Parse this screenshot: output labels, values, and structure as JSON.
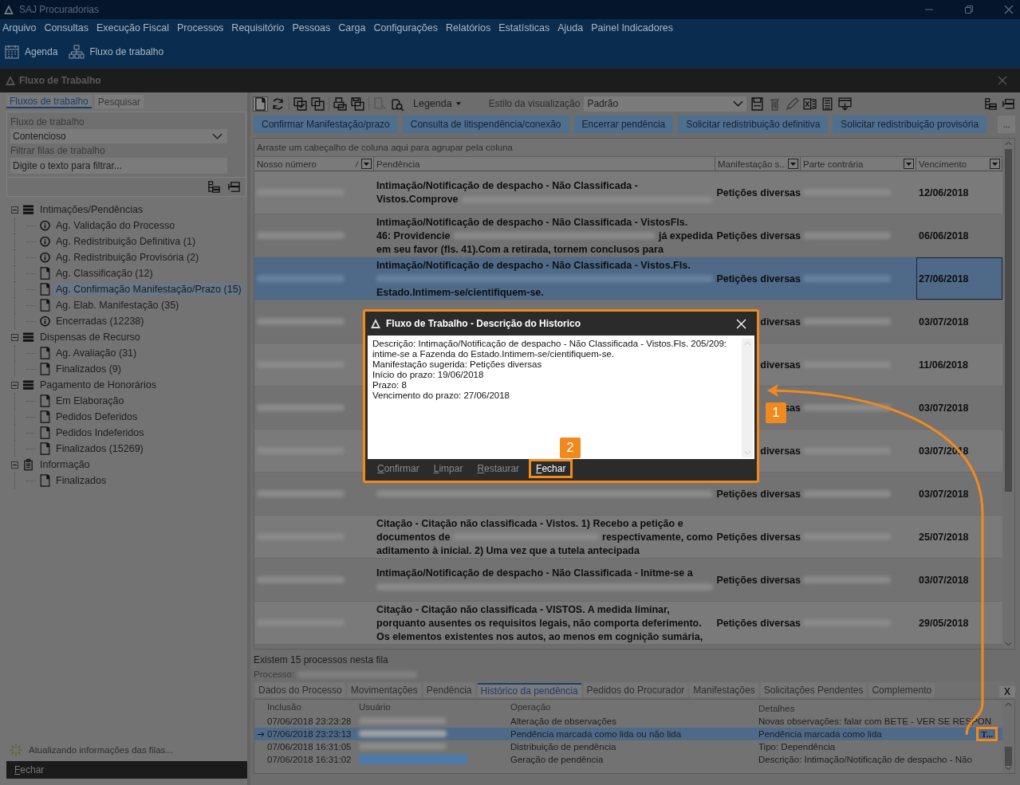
{
  "app_title": "SAJ Procuradorias",
  "menu": [
    "Arquivo",
    "Consultas",
    "Execução Fiscal",
    "Processos",
    "Requisitório",
    "Pessoas",
    "Carga",
    "Configurações",
    "Relatórios",
    "Estatísticas",
    "Ajuda",
    "Painel Indicadores"
  ],
  "quick_bar": [
    {
      "label": "Agenda",
      "kind": "calendar"
    },
    {
      "label": "Fluxo de trabalho",
      "kind": "hierarchy"
    }
  ],
  "window_title": "Fluxo de Trabalho",
  "left": {
    "tabs": [
      {
        "label": "Fluxos de trabalho",
        "selected": true
      },
      {
        "label": "Pesquisar",
        "selected": false
      }
    ],
    "workflow_label": "Fluxo de trabalho",
    "workflow_value": "Contencioso",
    "filter_label": "Filtrar filas de trabalho",
    "filter_placeholder": "Digite o texto para filtrar...",
    "tree": [
      {
        "label": "Intimações/Pendências",
        "kind": "list",
        "expanded": true,
        "selected": false,
        "children": [
          {
            "label": "Ag. Validação do Processo",
            "kind": "info",
            "selected": false
          },
          {
            "label": "Ag. Redistribuição Definitiva (1)",
            "kind": "info",
            "selected": false
          },
          {
            "label": "Ag. Redistribuição Provisória (2)",
            "kind": "info",
            "selected": false
          },
          {
            "label": "Ag. Classificação (12)",
            "kind": "doc",
            "selected": false
          },
          {
            "label": "Ag. Confirmação Manifestação/Prazo (15)",
            "kind": "doc",
            "selected": true
          },
          {
            "label": "Ag. Elab. Manifestação (35)",
            "kind": "doc",
            "selected": false
          },
          {
            "label": "Encerradas (12238)",
            "kind": "info",
            "selected": false
          }
        ]
      },
      {
        "label": "Dispensas de Recurso",
        "kind": "list",
        "expanded": true,
        "selected": false,
        "children": [
          {
            "label": "Ag. Avaliação (31)",
            "kind": "doc",
            "selected": false
          },
          {
            "label": "Finalizados (9)",
            "kind": "doc",
            "selected": false
          }
        ]
      },
      {
        "label": "Pagamento de Honorários",
        "kind": "list",
        "expanded": true,
        "selected": false,
        "children": [
          {
            "label": "Em Elaboração",
            "kind": "doc",
            "selected": false
          },
          {
            "label": "Pedidos Deferidos",
            "kind": "doc",
            "selected": false
          },
          {
            "label": "Pedidos Indeferidos",
            "kind": "doc",
            "selected": false
          },
          {
            "label": "Finalizados (15269)",
            "kind": "doc",
            "selected": false
          }
        ]
      },
      {
        "label": "Informação",
        "kind": "clipboard",
        "expanded": true,
        "selected": false,
        "children": [
          {
            "label": "Finalizados",
            "kind": "doc",
            "selected": false
          }
        ]
      }
    ],
    "status": "Atualizando informações das filas...",
    "close_button": "Fechar"
  },
  "toolbar": {
    "legend": "Legenda",
    "style_label": "Estilo da visualização",
    "style_value": "Padrão"
  },
  "actions": [
    "Confirmar Manifestação/prazo",
    "Consulta de litispendência/conexão",
    "Encerrar pendência",
    "Solicitar redistribuição definitiva",
    "Solicitar redistribuição provisória"
  ],
  "more_button": "...",
  "group_hint": "Arraste um cabeçalho de coluna aqui para agrupar pela coluna",
  "columns": [
    "Nosso número",
    "Pendência",
    "Manifestação s...",
    "Parte contrária",
    "Vencimento"
  ],
  "rows": [
    {
      "selected": false,
      "lines": [
        [
          {
            "kind": "text",
            "text": "Intimação/Notificação de despacho - Não Classificada -"
          }
        ],
        [
          {
            "kind": "text",
            "text": "Vistos.Comprove"
          },
          {
            "kind": "redacted"
          }
        ]
      ],
      "manifestation": "Petições diversas",
      "due": "12/06/2018"
    },
    {
      "selected": false,
      "lines": [
        [
          {
            "kind": "text",
            "text": "Intimação/Notificação de despacho - Não Classificada - VistosFls."
          }
        ],
        [
          {
            "kind": "text",
            "text": "46: Providencie"
          },
          {
            "kind": "redacted"
          },
          {
            "kind": "text",
            "text": "já expedida"
          }
        ],
        [
          {
            "kind": "text",
            "text": "em seu favor (fls. 41).Com a retirada, tornem conclusos para"
          }
        ]
      ],
      "manifestation": "Petições diversas",
      "due": "06/06/2018"
    },
    {
      "selected": true,
      "lines": [
        [
          {
            "kind": "text",
            "text": "Intimação/Notificação de despacho - Não Classificada - Vistos.Fls."
          }
        ],
        [
          {
            "kind": "redacted"
          }
        ],
        [
          {
            "kind": "text",
            "text": "Estado.Intimem-se/cientifiquem-se."
          }
        ]
      ],
      "manifestation": "Petições diversas",
      "due": "27/06/2018"
    },
    {
      "selected": false,
      "lines": [],
      "manifestation": "diversas",
      "due": "03/07/2018"
    },
    {
      "selected": false,
      "lines": [],
      "manifestation": "diversas",
      "due": "11/06/2018"
    },
    {
      "selected": false,
      "lines": [],
      "manifestation": "sas",
      "due": "03/07/2018"
    },
    {
      "selected": false,
      "lines": [],
      "manifestation": "diversas",
      "due": "03/07/2018"
    },
    {
      "selected": false,
      "lines": [
        [
          {
            "kind": "redacted"
          }
        ]
      ],
      "manifestation": "Petições diversas",
      "due": "03/07/2018"
    },
    {
      "selected": false,
      "lines": [
        [
          {
            "kind": "text",
            "text": "Citação - Citação não classificada - Vistos. 1) Recebo a petição e"
          }
        ],
        [
          {
            "kind": "text",
            "text": "documentos de"
          },
          {
            "kind": "redacted"
          },
          {
            "kind": "text",
            "text": "respectivamente, como"
          }
        ],
        [
          {
            "kind": "text",
            "text": "aditamento à inicial. 2) Uma vez que a tutela antecipada"
          }
        ]
      ],
      "manifestation": "Petições diversas",
      "due": "25/07/2018"
    },
    {
      "selected": false,
      "lines": [
        [
          {
            "kind": "text",
            "text": "Intimação/Notificação de despacho - Não Classificada - Initme-se a"
          }
        ],
        [
          {
            "kind": "redacted"
          }
        ]
      ],
      "manifestation": "Petições diversas",
      "due": "03/07/2018"
    },
    {
      "selected": false,
      "lines": [
        [
          {
            "kind": "text",
            "text": "Citação - Citação não classificada - VISTOS. A medida liminar,"
          }
        ],
        [
          {
            "kind": "text",
            "text": "porquanto ausentes os requisitos legais, não comporta deferimento."
          }
        ],
        [
          {
            "kind": "text",
            "text": "Os elementos existentes nos autos, ao menos em cognição sumária,"
          }
        ]
      ],
      "manifestation": "Petições diversas",
      "due": "29/05/2018"
    }
  ],
  "count_text": "Existem 15 processos nesta fila",
  "process_label": "Processo:",
  "detail_tabs": [
    {
      "label": "Dados do Processo",
      "selected": false
    },
    {
      "label": "Movimentações",
      "selected": false
    },
    {
      "label": "Pendência",
      "selected": false
    },
    {
      "label": "Histórico da pendência",
      "selected": true
    },
    {
      "label": "Pedidos do Procurador",
      "selected": false
    },
    {
      "label": "Manifestações",
      "selected": false
    },
    {
      "label": "Solicitações Pendentes",
      "selected": false
    },
    {
      "label": "Complemento",
      "selected": false
    }
  ],
  "detail_close": "X",
  "history": {
    "columns": [
      "Inclusão",
      "Usuário",
      "Operação",
      "Detalhes"
    ],
    "rows": [
      {
        "date": "07/06/2018 23:23:28",
        "operation": "Alteração de observações",
        "details": "Novas observações: falar com BETE - VER SE RESPON",
        "current": false,
        "selected": false
      },
      {
        "date": "07/06/2018 23:23:13",
        "operation": "Pendência marcada como lida ou não lida",
        "details": "Pendência marcada como lida",
        "current": true,
        "selected": true,
        "button": "T..."
      },
      {
        "date": "07/06/2018 16:31:05",
        "operation": "Distribuição de pendência",
        "details": "Tipo: Dependência",
        "current": false,
        "selected": false
      },
      {
        "date": "07/06/2018 16:31:02",
        "operation": "Geração de pendência",
        "details": "Descrição: Intimação/Notificação de despacho - Não",
        "current": false,
        "selected": false
      }
    ]
  },
  "dialog": {
    "title": "Fluxo de Trabalho - Descrição do Historico",
    "text_lines": [
      "Descrição: Intimação/Notificação de despacho - Não Classificada - Vistos.Fls. 205/209:",
      "intime-se a Fazenda do Estado.Intimem-se/cientifiquem-se.",
      "Manifestação sugerida: Petições diversas",
      "Início do prazo: 19/06/2018",
      "Prazo: 8",
      "Vencimento do prazo: 27/06/2018"
    ],
    "buttons": [
      {
        "label": "Confirmar",
        "disabled": true,
        "highlighted": false
      },
      {
        "label": "Limpar",
        "disabled": true,
        "highlighted": false
      },
      {
        "label": "Restaurar",
        "disabled": true,
        "highlighted": false
      },
      {
        "label": "Fechar",
        "disabled": false,
        "highlighted": true
      }
    ]
  },
  "annotations": [
    {
      "label": "1"
    },
    {
      "label": "2"
    }
  ]
}
